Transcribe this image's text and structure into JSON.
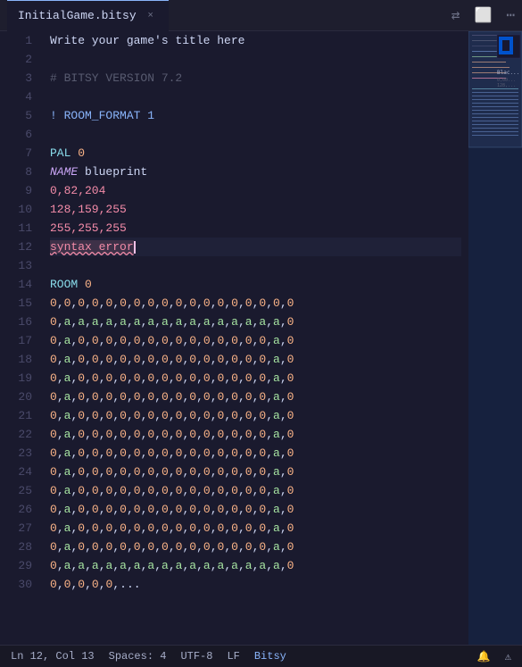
{
  "titleBar": {
    "tab_name": "InitialGame.bitsy",
    "close_icon": "×",
    "action_icons": [
      "⇄",
      "⬜",
      "⋯"
    ]
  },
  "editor": {
    "lines": [
      {
        "num": 1,
        "tokens": [
          {
            "t": "Write your game's title here",
            "c": "plain"
          }
        ]
      },
      {
        "num": 2,
        "tokens": []
      },
      {
        "num": 3,
        "tokens": [
          {
            "t": "# BITSY VERSION 7.2",
            "c": "comment"
          }
        ]
      },
      {
        "num": 4,
        "tokens": []
      },
      {
        "num": 5,
        "tokens": [
          {
            "t": "! ROOM_FORMAT 1",
            "c": "keyword"
          }
        ]
      },
      {
        "num": 6,
        "tokens": []
      },
      {
        "num": 7,
        "tokens": [
          {
            "t": "PAL ",
            "c": "room"
          },
          {
            "t": "0",
            "c": "number"
          }
        ]
      },
      {
        "num": 8,
        "tokens": [
          {
            "t": "NAME",
            "c": "keyword-italic"
          },
          {
            "t": " blueprint",
            "c": "plain"
          }
        ]
      },
      {
        "num": 9,
        "tokens": [
          {
            "t": "0,82,204",
            "c": "number-pink"
          }
        ]
      },
      {
        "num": 10,
        "tokens": [
          {
            "t": "128,159,255",
            "c": "number-pink"
          }
        ]
      },
      {
        "num": 11,
        "tokens": [
          {
            "t": "255,255,255",
            "c": "number-pink"
          }
        ]
      },
      {
        "num": 12,
        "tokens": [
          {
            "t": "syntax error",
            "c": "error"
          }
        ],
        "active": true
      },
      {
        "num": 13,
        "tokens": []
      },
      {
        "num": 14,
        "tokens": [
          {
            "t": "ROOM ",
            "c": "room"
          },
          {
            "t": "0",
            "c": "number"
          }
        ]
      },
      {
        "num": 15,
        "tokens": [
          {
            "t": "0,0,0,0,0,0,0,0,0,0,0,0,0,0,0,0,0,0",
            "c": "room-data"
          }
        ]
      },
      {
        "num": 16,
        "tokens": [
          {
            "t": "0,a,a,a,a,a,a,a,a,a,a,a,a,a,a,a,a,0",
            "c": "room-data"
          }
        ]
      },
      {
        "num": 17,
        "tokens": [
          {
            "t": "0,a,0,0,0,0,0,0,0,0,0,0,0,0,0,0,a,0",
            "c": "room-data"
          }
        ]
      },
      {
        "num": 18,
        "tokens": [
          {
            "t": "0,a,0,0,0,0,0,0,0,0,0,0,0,0,0,0,a,0",
            "c": "room-data"
          }
        ]
      },
      {
        "num": 19,
        "tokens": [
          {
            "t": "0,a,0,0,0,0,0,0,0,0,0,0,0,0,0,0,a,0",
            "c": "room-data"
          }
        ]
      },
      {
        "num": 20,
        "tokens": [
          {
            "t": "0,a,0,0,0,0,0,0,0,0,0,0,0,0,0,0,a,0",
            "c": "room-data"
          }
        ]
      },
      {
        "num": 21,
        "tokens": [
          {
            "t": "0,a,0,0,0,0,0,0,0,0,0,0,0,0,0,0,a,0",
            "c": "room-data"
          }
        ]
      },
      {
        "num": 22,
        "tokens": [
          {
            "t": "0,a,0,0,0,0,0,0,0,0,0,0,0,0,0,0,a,0",
            "c": "room-data"
          }
        ]
      },
      {
        "num": 23,
        "tokens": [
          {
            "t": "0,a,0,0,0,0,0,0,0,0,0,0,0,0,0,0,a,0",
            "c": "room-data"
          }
        ]
      },
      {
        "num": 24,
        "tokens": [
          {
            "t": "0,a,0,0,0,0,0,0,0,0,0,0,0,0,0,0,a,0",
            "c": "room-data"
          }
        ]
      },
      {
        "num": 25,
        "tokens": [
          {
            "t": "0,a,0,0,0,0,0,0,0,0,0,0,0,0,0,0,a,0",
            "c": "room-data"
          }
        ]
      },
      {
        "num": 26,
        "tokens": [
          {
            "t": "0,a,0,0,0,0,0,0,0,0,0,0,0,0,0,0,a,0",
            "c": "room-data"
          }
        ]
      },
      {
        "num": 27,
        "tokens": [
          {
            "t": "0,a,0,0,0,0,0,0,0,0,0,0,0,0,0,0,a,0",
            "c": "room-data"
          }
        ]
      },
      {
        "num": 28,
        "tokens": [
          {
            "t": "0,a,0,0,0,0,0,0,0,0,0,0,0,0,0,0,a,0",
            "c": "room-data"
          }
        ]
      },
      {
        "num": 29,
        "tokens": [
          {
            "t": "0,a,a,a,a,a,a,a,a,a,a,a,a,a,a,a,a,0",
            "c": "room-data"
          }
        ]
      },
      {
        "num": 30,
        "tokens": [
          {
            "t": "0,0,0,0,0,...",
            "c": "room-data"
          }
        ]
      }
    ]
  },
  "statusBar": {
    "position": "Ln 12, Col 13",
    "spaces": "Spaces: 4",
    "encoding": "UTF-8",
    "eol": "LF",
    "language": "Bitsy",
    "bell_icon": "🔔",
    "warning_icon": "⚠"
  }
}
